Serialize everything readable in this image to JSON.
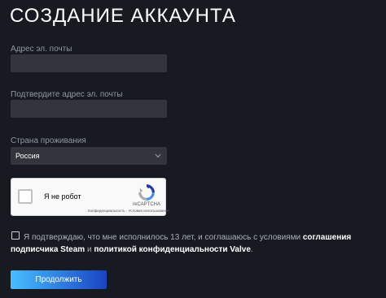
{
  "page": {
    "title": "СОЗДАНИЕ АККАУНТА"
  },
  "form": {
    "email_label": "Адрес эл. почты",
    "email_value": "",
    "confirm_email_label": "Подтвердите адрес эл. почты",
    "confirm_email_value": "",
    "country_label": "Страна проживания",
    "country_value": "Россия"
  },
  "captcha": {
    "label": "Я не робот",
    "brand": "reCAPTCHA",
    "links": "Конфиденциальность - Условия использования",
    "checked": false
  },
  "agreement": {
    "text_part1": "Я подтверждаю, что мне исполнилось 13 лет, и соглашаюсь с условиями ",
    "link1": "соглашения подписчика Steam",
    "text_part2": " и ",
    "link2": "политикой конфиденциальности Valve",
    "text_part3": ".",
    "checked": false
  },
  "actions": {
    "continue_label": "Продолжить"
  },
  "colors": {
    "background": "#171a21",
    "input_bg": "#32353c",
    "button_gradient_start": "#47bfff",
    "button_gradient_end": "#1a44c2"
  }
}
